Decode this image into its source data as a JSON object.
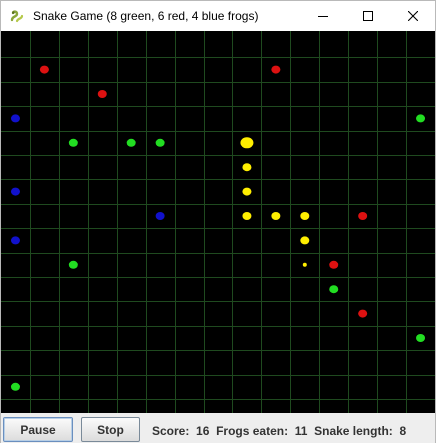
{
  "window": {
    "title": "Snake Game (8 green, 6 red, 4 blue frogs)",
    "app_icon": "snake-icon",
    "controls": [
      "minimize-icon",
      "maximize-icon",
      "close-icon"
    ]
  },
  "board": {
    "background": "#000000",
    "grid_color": "#1f4a1f",
    "columns": 15,
    "rows": 15,
    "colors": {
      "green": "#22dd22",
      "red": "#dd1111",
      "blue": "#1111cc",
      "snake": "#ffee00"
    },
    "frogs": [
      {
        "color": "red",
        "col": 1,
        "row": 1
      },
      {
        "color": "red",
        "col": 9,
        "row": 1
      },
      {
        "color": "red",
        "col": 3,
        "row": 2
      },
      {
        "color": "blue",
        "col": 0,
        "row": 3
      },
      {
        "color": "green",
        "col": 14,
        "row": 3
      },
      {
        "color": "green",
        "col": 2,
        "row": 4
      },
      {
        "color": "green",
        "col": 4,
        "row": 4
      },
      {
        "color": "green",
        "col": 5,
        "row": 4
      },
      {
        "color": "blue",
        "col": 0,
        "row": 6
      },
      {
        "color": "blue",
        "col": 5,
        "row": 7
      },
      {
        "color": "red",
        "col": 12,
        "row": 7
      },
      {
        "color": "blue",
        "col": 0,
        "row": 8
      },
      {
        "color": "green",
        "col": 2,
        "row": 9
      },
      {
        "color": "red",
        "col": 11,
        "row": 9
      },
      {
        "color": "green",
        "col": 11,
        "row": 10
      },
      {
        "color": "red",
        "col": 12,
        "row": 11
      },
      {
        "color": "green",
        "col": 14,
        "row": 12
      },
      {
        "color": "green",
        "col": 0,
        "row": 14
      }
    ],
    "snake": [
      {
        "col": 8,
        "row": 4,
        "part": "head"
      },
      {
        "col": 8,
        "row": 5,
        "part": "body"
      },
      {
        "col": 8,
        "row": 6,
        "part": "body"
      },
      {
        "col": 8,
        "row": 7,
        "part": "body"
      },
      {
        "col": 9,
        "row": 7,
        "part": "body"
      },
      {
        "col": 10,
        "row": 7,
        "part": "body"
      },
      {
        "col": 10,
        "row": 8,
        "part": "body"
      },
      {
        "col": 10,
        "row": 9,
        "part": "tail"
      }
    ]
  },
  "controls": {
    "pause_label": "Pause",
    "stop_label": "Stop"
  },
  "stats": {
    "score_label": "Score:",
    "score": "16",
    "frogs_label": "Frogs eaten:",
    "frogs_eaten": "11",
    "length_label": "Snake length:",
    "snake_length": "8"
  }
}
